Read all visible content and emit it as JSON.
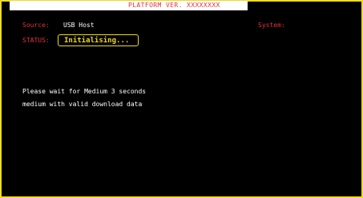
{
  "header": {
    "platform_version": "PLATFORM VER. XXXXXXXX"
  },
  "fields": {
    "source_label": "Source:",
    "source_value": "USB Host",
    "system_label": "System:",
    "status_label": "STATUS:",
    "status_value": "Initialising..."
  },
  "messages": [
    "Please wait for Medium 3 seconds",
    "medium with valid download data"
  ],
  "colors": {
    "border": "#f2dc1a",
    "label": "#e4343a",
    "text": "#ffffff",
    "status": "#f2dc1a",
    "background": "#000000"
  }
}
